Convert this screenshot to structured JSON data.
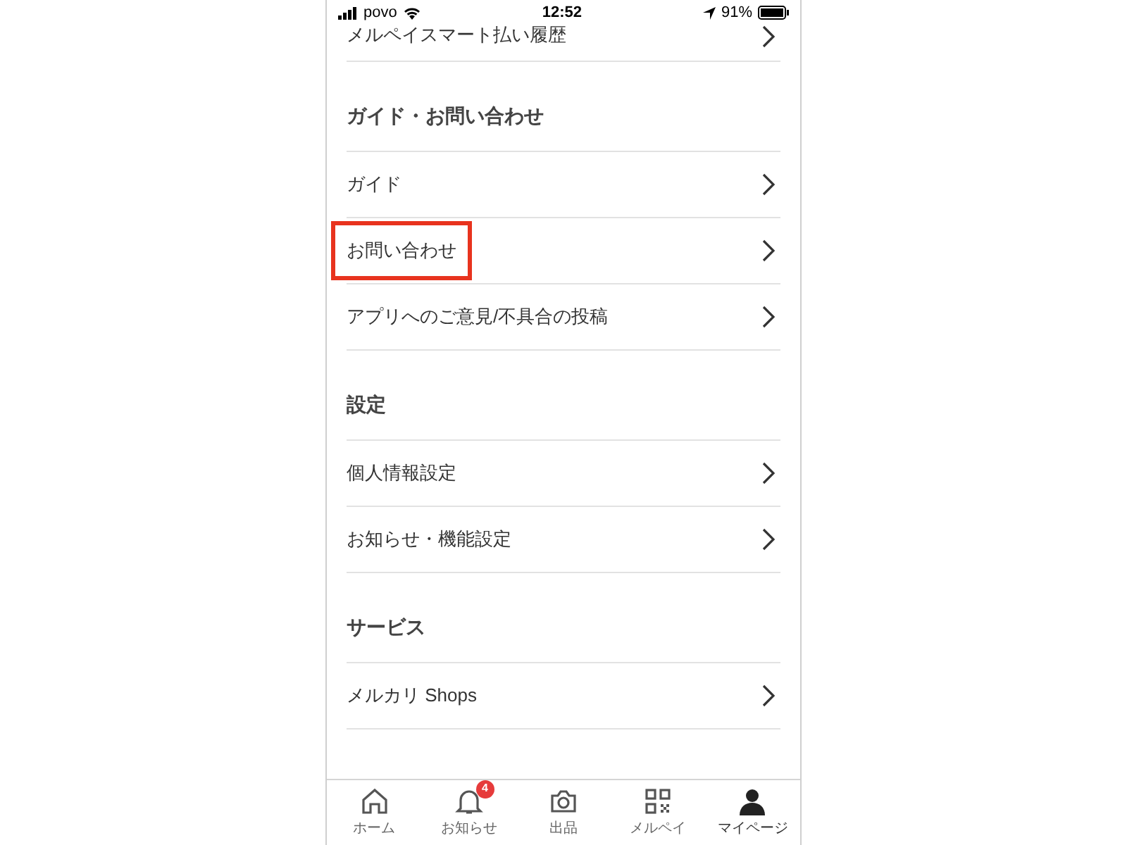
{
  "status_bar": {
    "carrier": "povo",
    "time": "12:52",
    "battery": "91%"
  },
  "top_item": {
    "label": "メルペイスマート払い履歴"
  },
  "sections": [
    {
      "title": "ガイド・お問い合わせ",
      "items": [
        {
          "label": "ガイド",
          "highlighted": false
        },
        {
          "label": "お問い合わせ",
          "highlighted": true
        },
        {
          "label": "アプリへのご意見/不具合の投稿",
          "highlighted": false
        }
      ]
    },
    {
      "title": "設定",
      "items": [
        {
          "label": "個人情報設定",
          "highlighted": false
        },
        {
          "label": "お知らせ・機能設定",
          "highlighted": false
        }
      ]
    },
    {
      "title": "サービス",
      "items": [
        {
          "label": "メルカリ Shops",
          "highlighted": false
        }
      ]
    }
  ],
  "tab_bar": [
    {
      "kind": "home",
      "label": "ホーム",
      "selected": false
    },
    {
      "kind": "bell",
      "label": "お知らせ",
      "badge": "4",
      "selected": false
    },
    {
      "kind": "camera",
      "label": "出品",
      "selected": false
    },
    {
      "kind": "qr",
      "label": "メルペイ",
      "selected": false
    },
    {
      "kind": "person",
      "label": "マイページ",
      "selected": true
    }
  ]
}
